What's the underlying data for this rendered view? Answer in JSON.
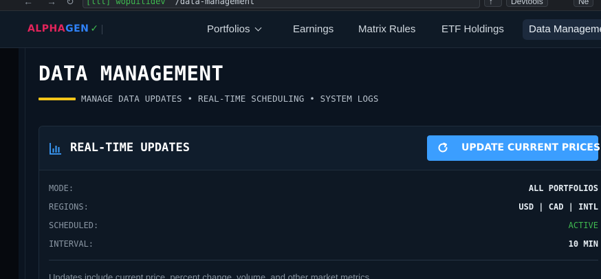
{
  "browser": {
    "url_env": "[lll] wopuitidev",
    "url_path": "/data-management",
    "devtools_label": "Devtools",
    "extra_label": "Ne"
  },
  "header": {
    "logo_part1": "ALPHA",
    "logo_part2": "GEN",
    "logo_check": "✓",
    "nav": [
      {
        "label": "Portfolios"
      },
      {
        "label": "Earnings"
      },
      {
        "label": "Matrix Rules"
      },
      {
        "label": "ETF Holdings"
      },
      {
        "label": "Data Management"
      }
    ]
  },
  "page": {
    "title": "DATA MANAGEMENT",
    "subtitle": "MANAGE DATA UPDATES • REAL-TIME SCHEDULING • SYSTEM LOGS"
  },
  "card": {
    "title": "REAL-TIME UPDATES",
    "button_label": "UPDATE CURRENT PRICES",
    "rows": [
      {
        "key": "MODE:",
        "value": "ALL PORTFOLIOS"
      },
      {
        "key": "REGIONS:",
        "value": "USD | CAD | INTL"
      },
      {
        "key": "SCHEDULED:",
        "value": "ACTIVE"
      },
      {
        "key": "INTERVAL:",
        "value": "10 MIN"
      }
    ],
    "note": "Updates include current price, percent change, volume, and other market metrics."
  },
  "colors": {
    "accent_blue": "#3b9eff",
    "title_underline": "#f5c518",
    "status_active": "#3fb950",
    "logo_red": "#e3245b",
    "logo_blue": "#2f81f7"
  },
  "icons": [
    "back-arrow-icon",
    "forward-arrow-icon",
    "reload-icon",
    "chevron-down-icon",
    "bar-chart-icon",
    "refresh-icon"
  ]
}
